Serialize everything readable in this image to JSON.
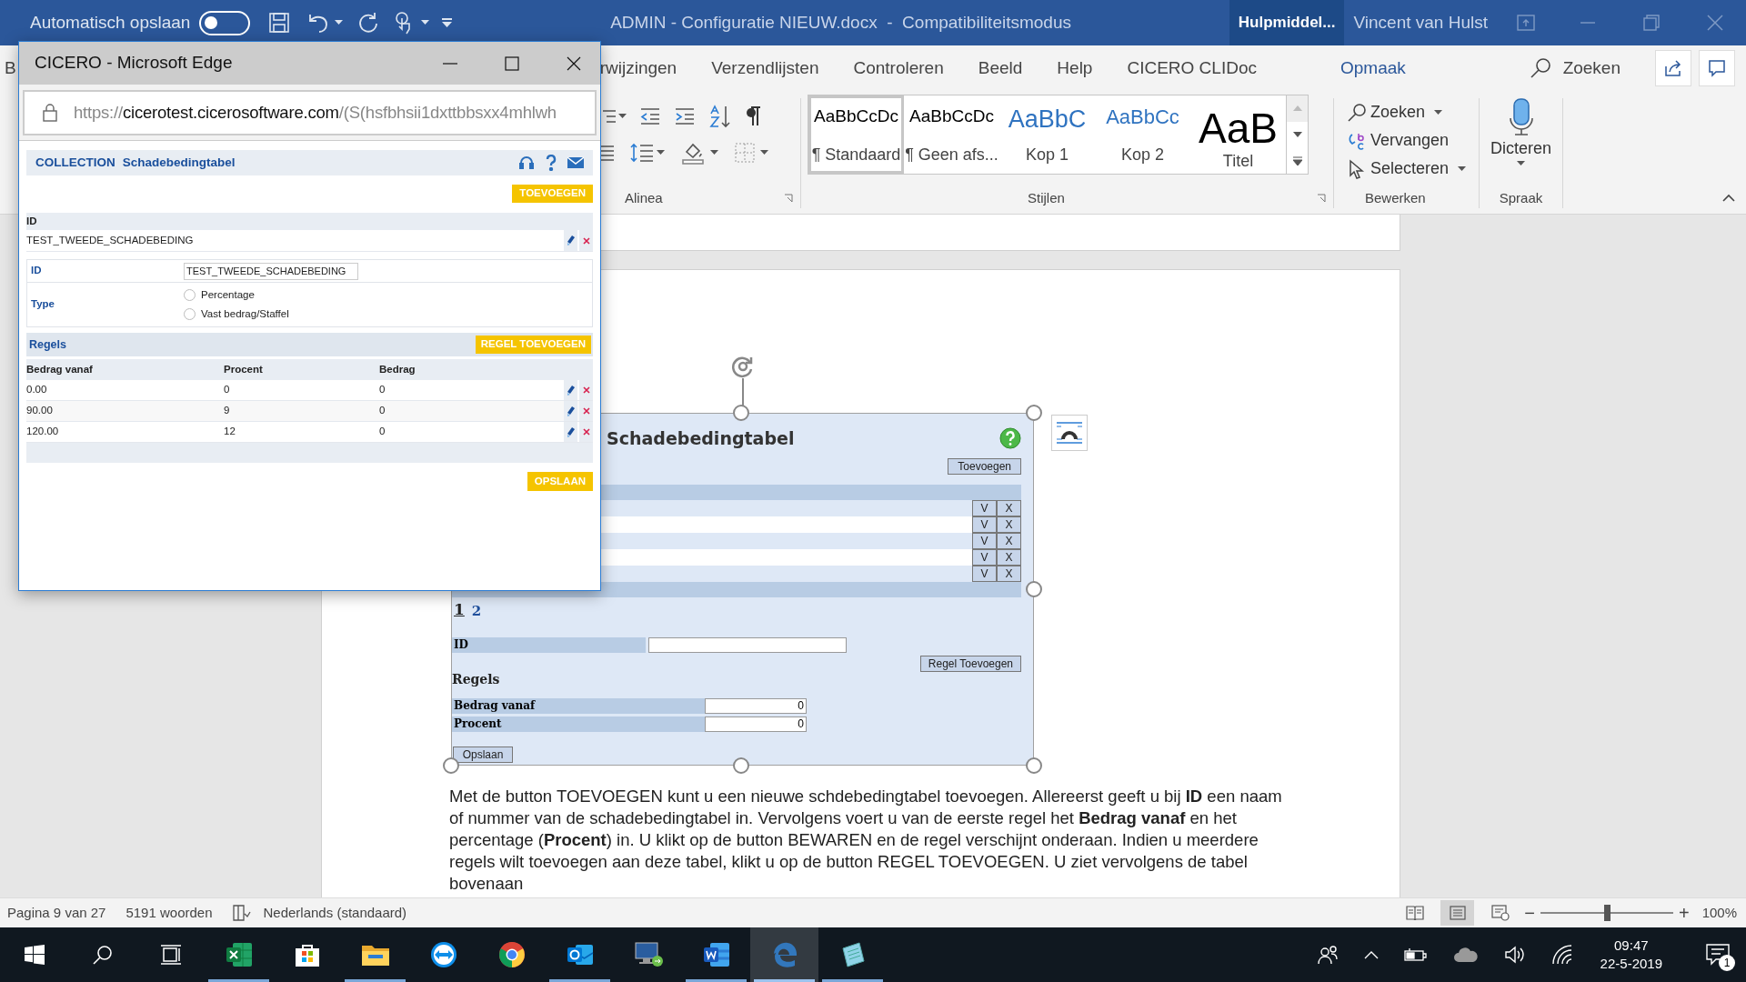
{
  "word": {
    "title_bar": {
      "autosave_label": "Automatisch opslaan",
      "autosave_on": false,
      "title": "ADMIN - Configuratie NIEUW.docx  -  Compatibiliteitsmodus",
      "context_tab": "Hulpmiddel...",
      "user": "Vincent van Hulst"
    },
    "ribbon_tabs": [
      {
        "label": "B",
        "selected": false,
        "kind": "tab"
      },
      {
        "label": "rwijzingen",
        "selected": false,
        "kind": "tab"
      },
      {
        "label": "Verzendlijsten",
        "selected": false,
        "kind": "tab"
      },
      {
        "label": "Controleren",
        "selected": false,
        "kind": "tab"
      },
      {
        "label": "Beeld",
        "selected": false,
        "kind": "tab"
      },
      {
        "label": "Help",
        "selected": false,
        "kind": "tab"
      },
      {
        "label": "CICERO CLIDoc",
        "selected": false,
        "kind": "tab"
      },
      {
        "label": "Opmaak",
        "selected": true,
        "kind": "contextual"
      }
    ],
    "search_label": "Zoeken",
    "ribbon": {
      "paragraph": {
        "label": "Alinea"
      },
      "styles": {
        "label": "Stijlen",
        "items": [
          {
            "preview": "AaBbCcDc",
            "name": "¶ Standaard",
            "selected": true,
            "kind": "normal"
          },
          {
            "preview": "AaBbCcDc",
            "name": "¶ Geen afs...",
            "selected": false,
            "kind": "nospacing"
          },
          {
            "preview": "AaBbC",
            "name": "Kop 1",
            "selected": false,
            "kind": "heading1"
          },
          {
            "preview": "AaBbCc",
            "name": "Kop 2",
            "selected": false,
            "kind": "heading2"
          },
          {
            "preview": "AaB",
            "name": "Titel",
            "selected": false,
            "kind": "title"
          }
        ]
      },
      "editing": {
        "label": "Bewerken",
        "items": [
          {
            "label": "Zoeken",
            "kind": "find"
          },
          {
            "label": "Vervangen",
            "kind": "replace"
          },
          {
            "label": "Selecteren",
            "kind": "select"
          }
        ]
      },
      "voice": {
        "label": "Spraak",
        "button": "Dicteren"
      }
    },
    "document": {
      "embedded": {
        "heading": "Schadebedingtabel",
        "add_button": "Toevoegen",
        "grid_rows": [
          {
            "buttons": [
              "V",
              "X"
            ]
          },
          {
            "buttons": [
              "V",
              "X"
            ]
          },
          {
            "buttons": [
              "V",
              "X"
            ]
          },
          {
            "buttons": [
              "V",
              "X"
            ]
          },
          {
            "buttons": [
              "V",
              "X"
            ]
          }
        ],
        "pages": [
          {
            "label": "1",
            "selected": true
          },
          {
            "label": "2",
            "selected": false
          }
        ],
        "id_label": "ID",
        "add_rule_button": "Regel Toevoegen",
        "rules_heading": "Regels",
        "fields": [
          {
            "label": "Bedrag vanaf",
            "value": "0"
          },
          {
            "label": "Procent",
            "value": "0"
          }
        ],
        "save_button": "Opslaan"
      },
      "paragraph": "Met de button TOEVOEGEN kunt u een nieuwe schdebedingtabel toevoegen. Allereerst geeft u bij **ID** een naam of nummer van de schadebedingtabel in. Vervolgens voert u van de eerste regel het **Bedrag vanaf** en het percentage (**Procent**) in. U klikt op de button BEWAREN en de regel verschijnt onderaan. Indien u meerdere regels wilt toevoegen aan deze tabel, klikt u op de button REGEL TOEVOEGEN. U ziet vervolgens de tabel bovenaan"
    },
    "status_bar": {
      "page": "Pagina 9 van 27",
      "words": "5191 woorden",
      "language": "Nederlands (standaard)",
      "views": [
        {
          "kind": "read",
          "selected": false
        },
        {
          "kind": "print",
          "selected": true
        },
        {
          "kind": "web",
          "selected": false
        }
      ],
      "zoom_out": "−",
      "zoom_slider": {
        "level": 0.5
      },
      "zoom_in": "+",
      "zoom": "100%"
    }
  },
  "edge_window": {
    "title": "CICERO - Microsoft Edge",
    "url": {
      "scheme": "https://",
      "host": "cicerotest.cicerosoftware.com",
      "path": "/(S(hsfbhsii1dxttbbsxx4mhlwh"
    },
    "app": {
      "section": "COLLECTION",
      "name": "Schadebedingtabel",
      "add_button": "TOEVOEGEN",
      "list": {
        "column": "ID",
        "rows": [
          "TEST_TWEEDE_SCHADEBEDING"
        ]
      },
      "form": {
        "id_label": "ID",
        "id_value": "TEST_TWEEDE_SCHADEBEDING",
        "type_label": "Type",
        "type_options": [
          {
            "label": "Percentage",
            "selected": false
          },
          {
            "label": "Vast bedrag/Staffel",
            "selected": false
          }
        ]
      },
      "rules": {
        "title": "Regels",
        "add_button": "REGEL TOEVOEGEN",
        "columns": [
          "Bedrag vanaf",
          "Procent",
          "Bedrag"
        ],
        "rows": [
          [
            "0.00",
            "0",
            "0"
          ],
          [
            "90.00",
            "9",
            "0"
          ],
          [
            "120.00",
            "12",
            "0"
          ]
        ]
      },
      "save_button": "OPSLAAN"
    }
  },
  "taskbar": {
    "apps": [
      {
        "kind": "start",
        "running": false,
        "active": false
      },
      {
        "kind": "search",
        "running": false,
        "active": false
      },
      {
        "kind": "taskview",
        "running": false,
        "active": false
      },
      {
        "kind": "excel",
        "running": true,
        "active": false
      },
      {
        "kind": "store",
        "running": false,
        "active": false
      },
      {
        "kind": "explorer",
        "running": true,
        "active": false
      },
      {
        "kind": "teamviewer",
        "running": false,
        "active": false
      },
      {
        "kind": "chrome",
        "running": false,
        "active": false
      },
      {
        "kind": "outlook",
        "running": true,
        "active": false
      },
      {
        "kind": "remote",
        "running": false,
        "active": false
      },
      {
        "kind": "word",
        "running": true,
        "active": false
      },
      {
        "kind": "edge",
        "running": true,
        "active": true
      },
      {
        "kind": "notes",
        "running": true,
        "active": false
      }
    ],
    "time": "09:47",
    "date": "22-5-2019",
    "notifications": "1"
  }
}
